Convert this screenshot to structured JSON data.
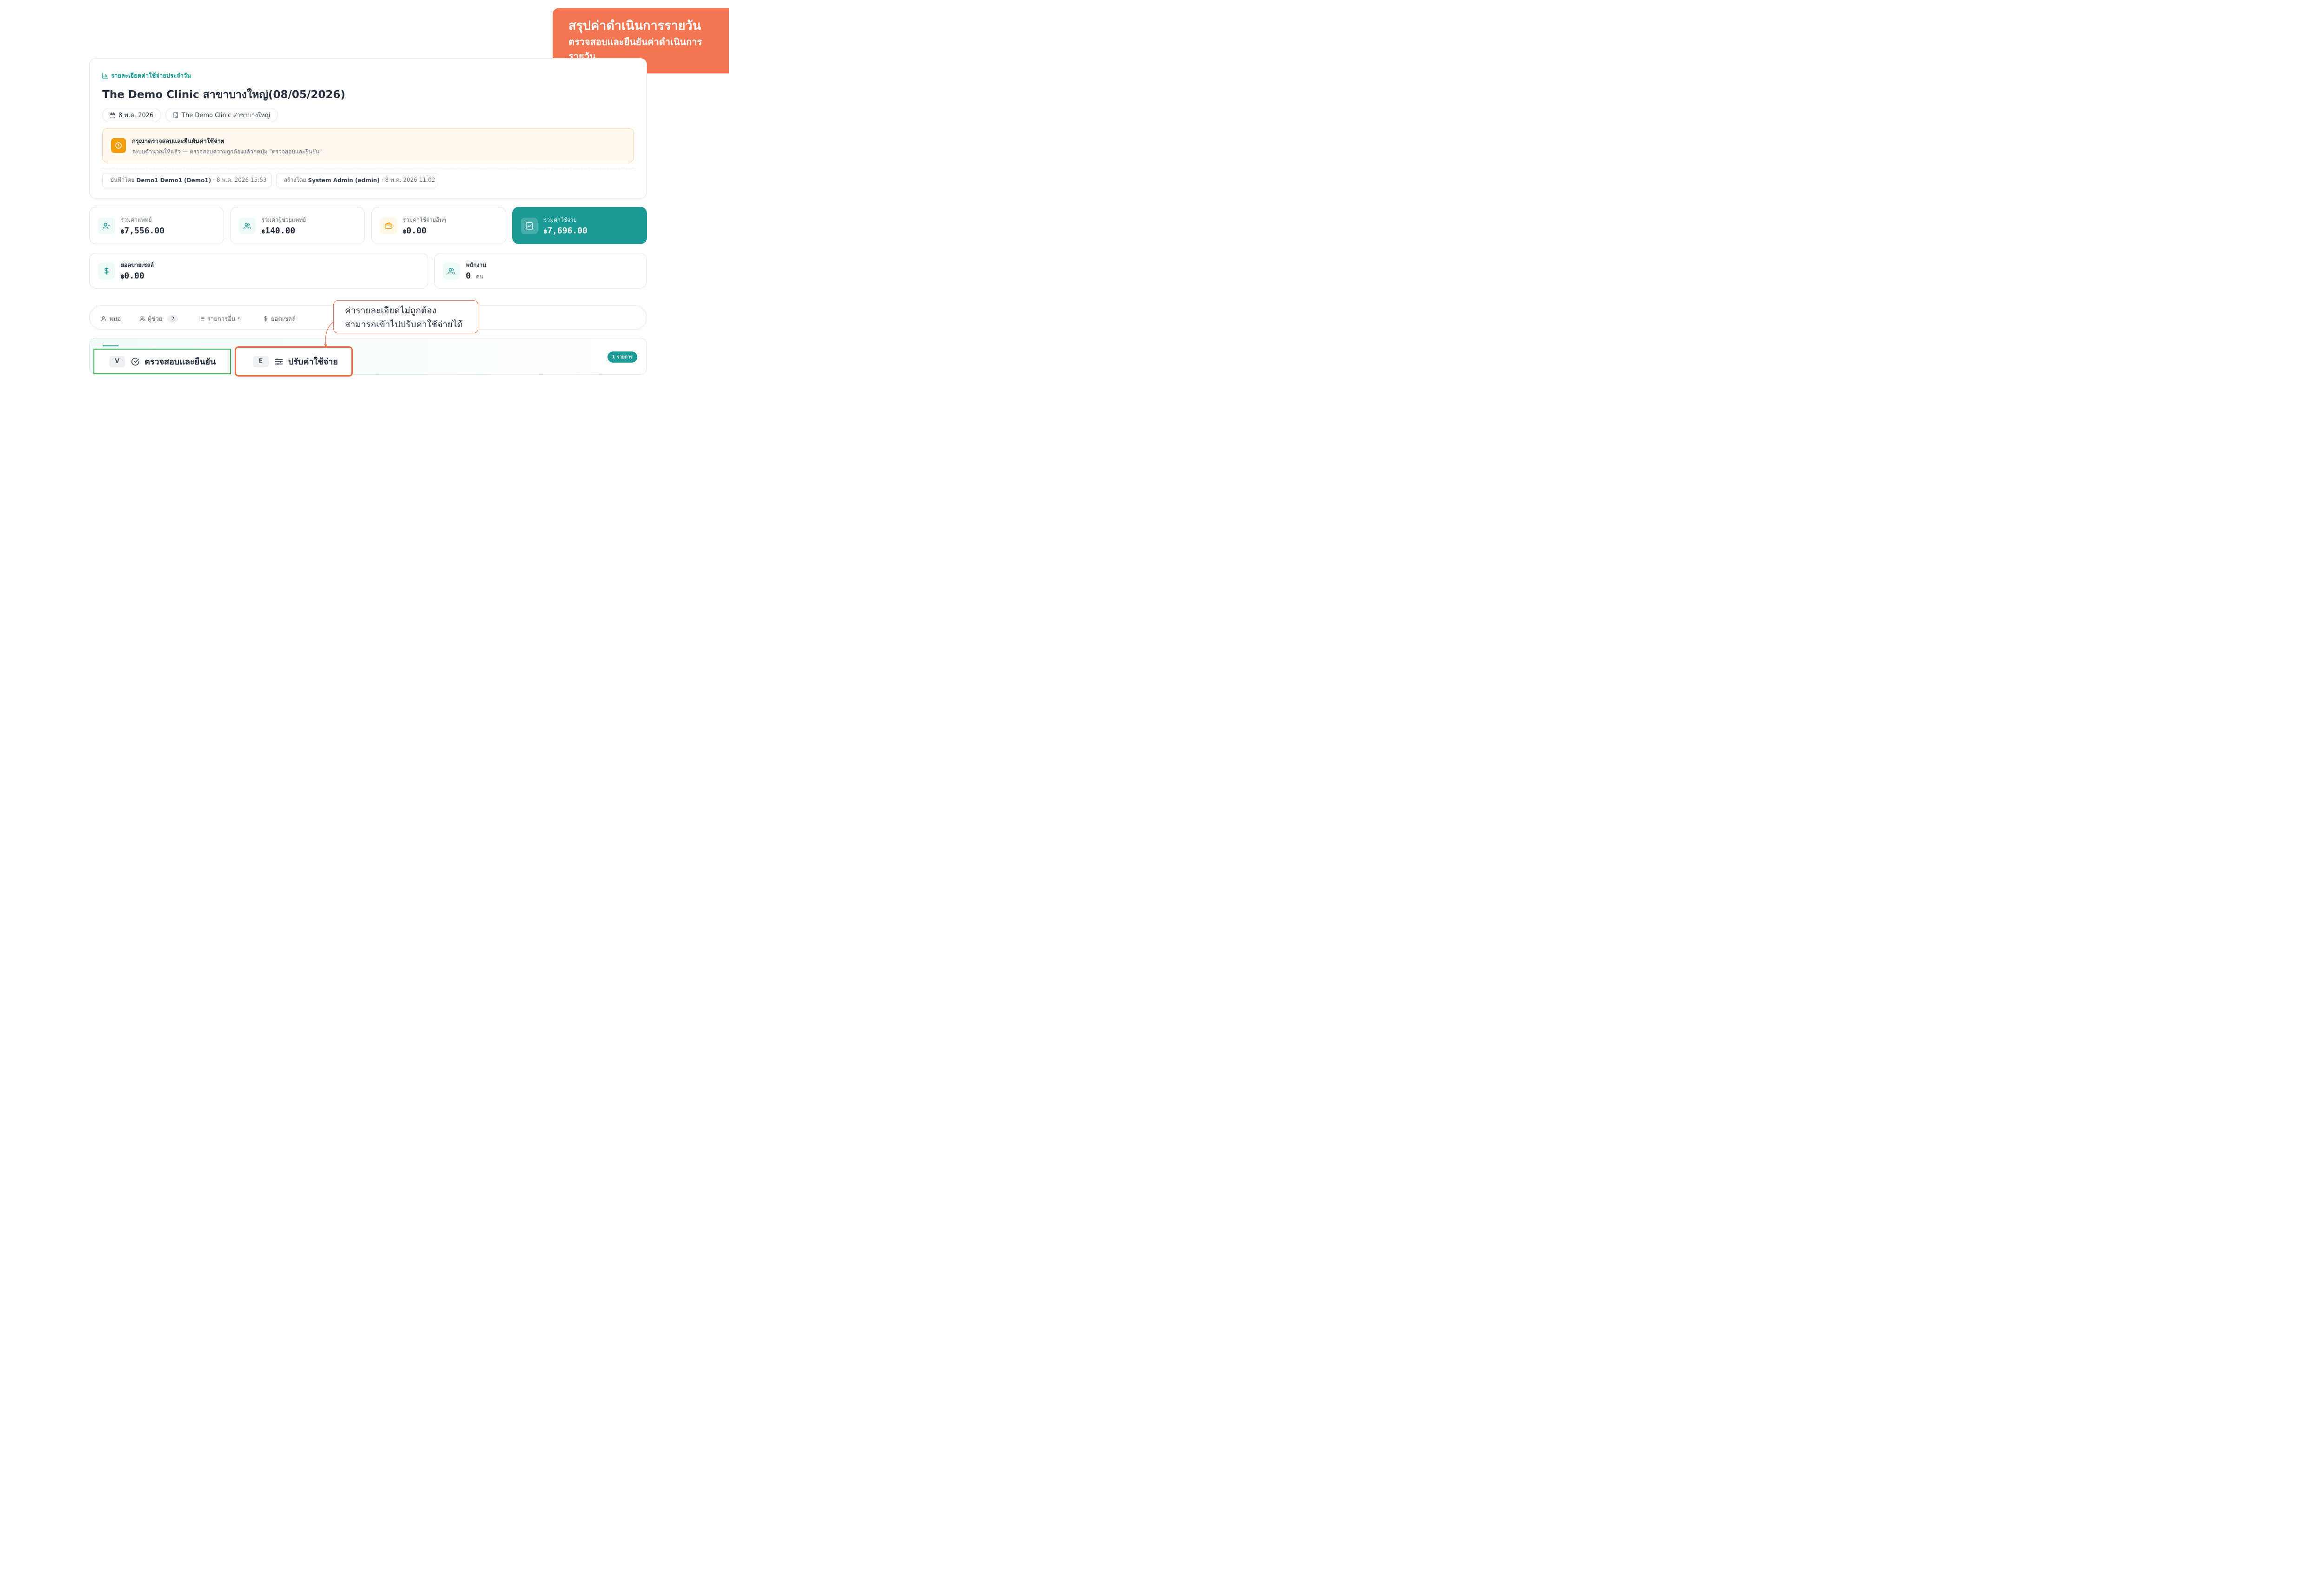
{
  "callout_top": {
    "title": "สรุปค่าดำเนินการรายวัน",
    "subtitle": "ตรวจสอบและยืนยันค่าดำเนินการรายวัน"
  },
  "header": {
    "kicker": "รายละเอียดค่าใช้จ่ายประจำวัน",
    "title": "The Demo Clinic สาขาบางใหญ่(08/05/2026)",
    "date_chip": "8 พ.ค. 2026",
    "branch_chip": "The Demo Clinic สาขาบางใหญ่"
  },
  "alert": {
    "title": "กรุณาตรวจสอบและยืนยันค่าใช้จ่าย",
    "description": "ระบบคำนวณให้แล้ว — ตรวจสอบความถูกต้องแล้วกดปุ่ม \"ตรวจสอบและยืนยัน\""
  },
  "meta": {
    "saved_label": "บันทึกโดย",
    "saved_by": "Demo1 Demo1 (Demo1)",
    "saved_at": "· 8 พ.ค. 2026 15:53",
    "created_label": "สร้างโดย",
    "created_by": "System Admin (admin)",
    "created_at": "· 8 พ.ค. 2026 11:02"
  },
  "stats": {
    "doctor": {
      "label": "รวมค่าแพทย์",
      "currency": "฿",
      "value": "7,556.00"
    },
    "assistant": {
      "label": "รวมค่าผู้ช่วยแพทย์",
      "currency": "฿",
      "value": "140.00"
    },
    "other": {
      "label": "รวมค่าใช้จ่ายอื่นๆ",
      "currency": "฿",
      "value": "0.00"
    },
    "total": {
      "label": "รวมค่าใช้จ่าย",
      "currency": "฿",
      "value": "7,696.00"
    },
    "sales": {
      "label": "ยอดขายเซลล์",
      "currency": "฿",
      "value": "0.00"
    },
    "staff": {
      "label": "พนักงาน",
      "value": "0",
      "unit": "คน"
    }
  },
  "tabs": [
    {
      "label": "หมอ"
    },
    {
      "label": "ผู้ช่วย",
      "count": "2"
    },
    {
      "label": "รายการอื่น ๆ"
    },
    {
      "label": "ยอดเซลล์"
    }
  ],
  "panel": {
    "badge": "1 รายการ"
  },
  "actions": {
    "confirm": {
      "key": "V",
      "label": "ตรวจสอบและยืนยัน"
    },
    "adjust": {
      "key": "E",
      "label": "ปรับค่าใช้จ่าย"
    }
  },
  "callout_mid": {
    "line1": "ค่ารายละเอียดไม่ถูกต้อง",
    "line2": "สามารถเข้าไปปรับค่าใช้จ่ายได้"
  },
  "colors": {
    "accent": "#1c9a96",
    "callout": "#f47551",
    "confirm_outline": "#3cb55a",
    "warning": "#f59e0b"
  }
}
